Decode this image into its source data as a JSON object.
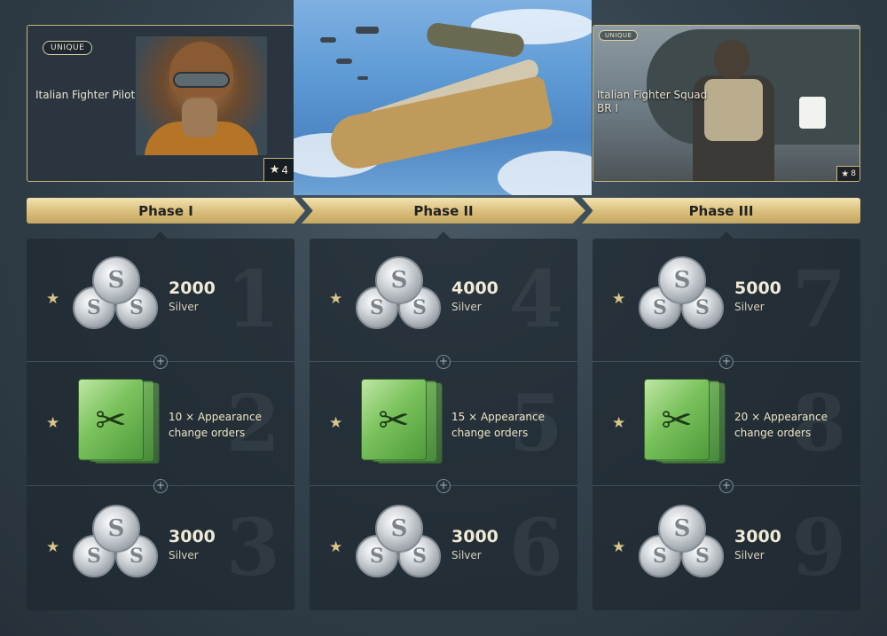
{
  "cards": {
    "pilot": {
      "badge": "UNIQUE",
      "title": "Italian Fighter Pilot",
      "rank": "4"
    },
    "squad": {
      "badge": "UNIQUE",
      "title_line1": "Italian Fighter Squad",
      "title_line2": "BR I",
      "rank": "8"
    }
  },
  "phases": [
    {
      "label": "Phase I"
    },
    {
      "label": "Phase II"
    },
    {
      "label": "Phase III"
    }
  ],
  "columns": [
    {
      "rewards": [
        {
          "number": "1",
          "type": "silver",
          "amount": "2000",
          "label": "Silver"
        },
        {
          "number": "2",
          "type": "orders",
          "text_line1": "10 × Appearance",
          "text_line2": "change orders"
        },
        {
          "number": "3",
          "type": "silver",
          "amount": "3000",
          "label": "Silver"
        }
      ]
    },
    {
      "rewards": [
        {
          "number": "4",
          "type": "silver",
          "amount": "4000",
          "label": "Silver"
        },
        {
          "number": "5",
          "type": "orders",
          "text_line1": "15 × Appearance",
          "text_line2": "change orders"
        },
        {
          "number": "6",
          "type": "silver",
          "amount": "3000",
          "label": "Silver"
        }
      ]
    },
    {
      "rewards": [
        {
          "number": "7",
          "type": "silver",
          "amount": "5000",
          "label": "Silver"
        },
        {
          "number": "8",
          "type": "orders",
          "text_line1": "20 × Appearance",
          "text_line2": "change orders"
        },
        {
          "number": "9",
          "type": "silver",
          "amount": "3000",
          "label": "Silver"
        }
      ]
    }
  ],
  "icons": {
    "star": "star-icon",
    "plus": "plus-icon",
    "coin_glyph": "S",
    "scissors_glyph": "✂",
    "star_glyph": "★",
    "plus_glyph": "+"
  },
  "colors": {
    "accent_gold": "#d9bd7a",
    "card_border": "#c9b57a",
    "order_green": "#7ac25c"
  }
}
